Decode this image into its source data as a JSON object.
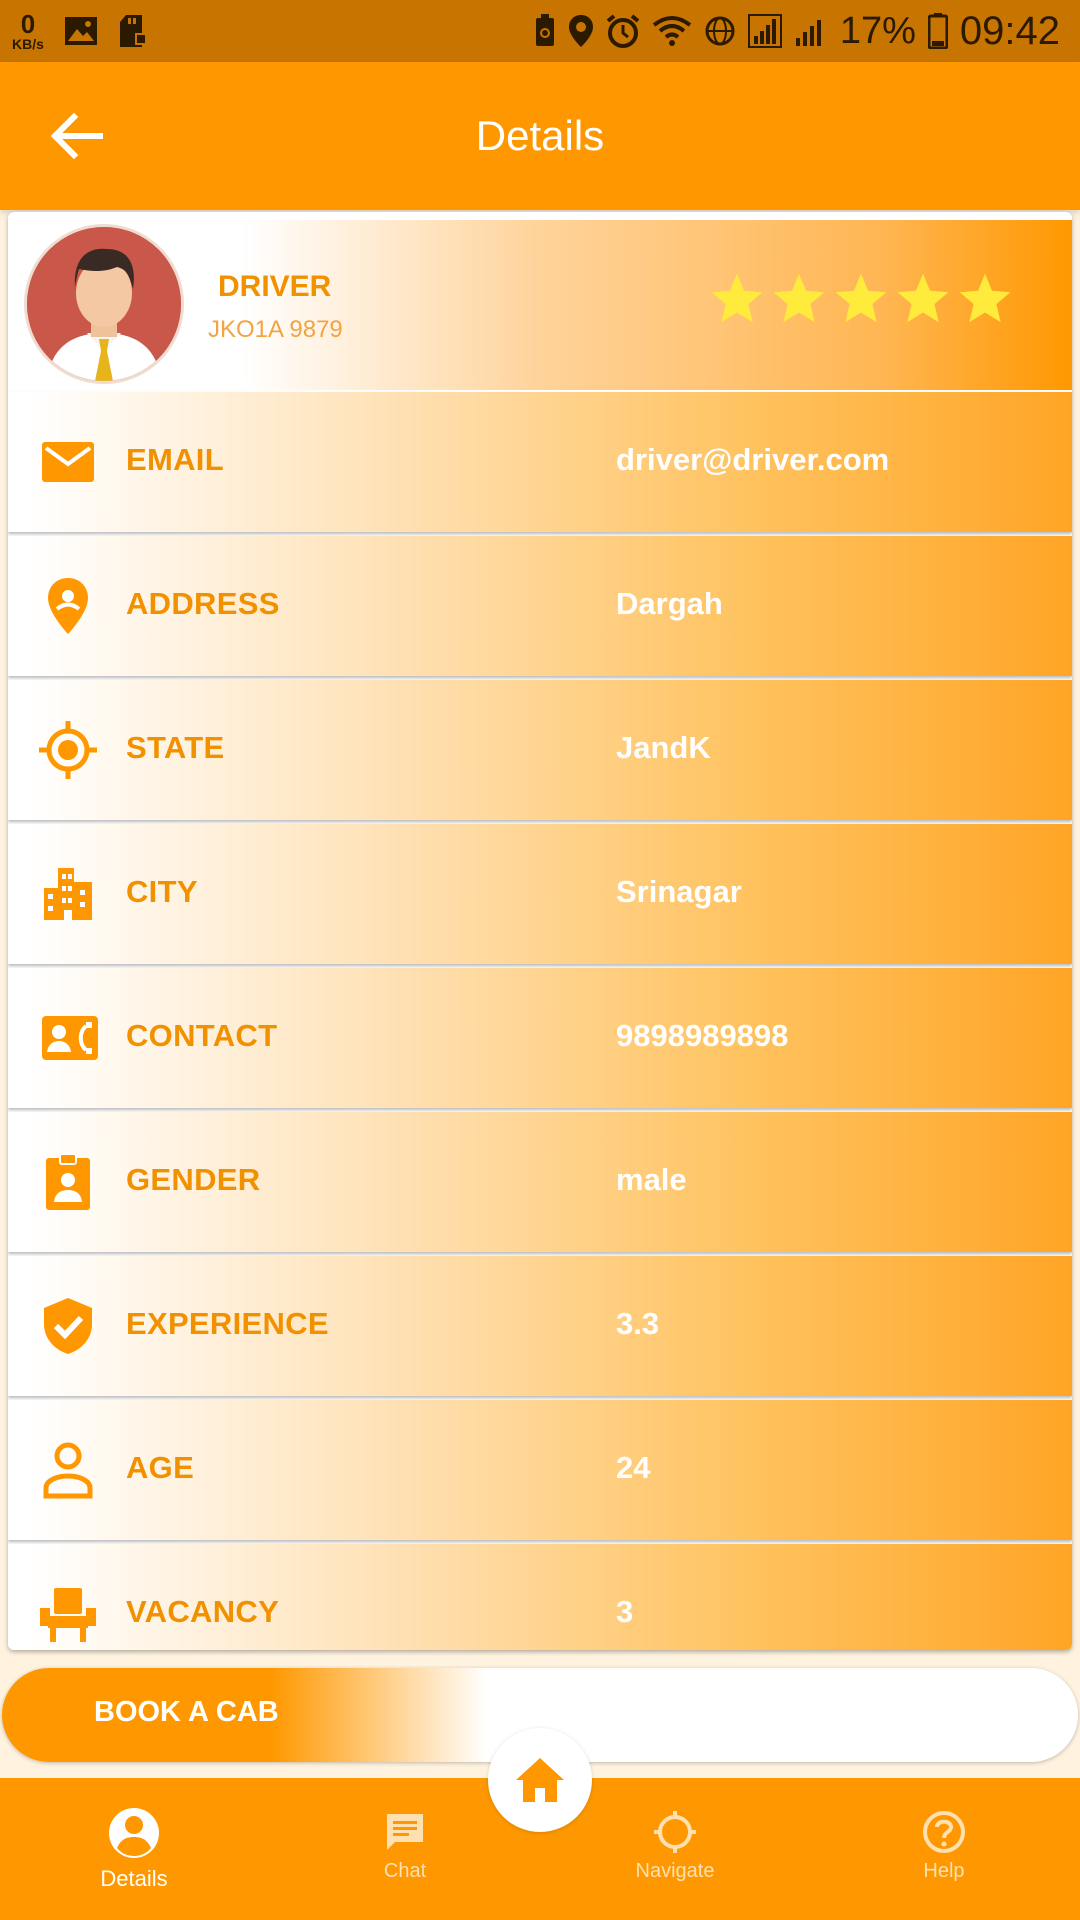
{
  "status_bar": {
    "net_speed_value": "0",
    "net_speed_unit": "KB/s",
    "battery": "17%",
    "time": "09:42",
    "icons": [
      "gallery-icon",
      "sd-card-icon",
      "recycle-icon",
      "location-icon",
      "alarm-icon",
      "wifi-icon",
      "globe-icon",
      "signal-icon",
      "battery-icon"
    ]
  },
  "appbar": {
    "title": "Details",
    "back_icon": "arrow-back-icon"
  },
  "profile": {
    "name": "DRIVER",
    "vehicle_number": "JKO1A 9879",
    "rating": 5,
    "rating_max": 5
  },
  "details": [
    {
      "icon": "email-icon",
      "label": "EMAIL",
      "value": "driver@driver.com"
    },
    {
      "icon": "location-pin-icon",
      "label": "ADDRESS",
      "value": "Dargah"
    },
    {
      "icon": "gps-target-icon",
      "label": "STATE",
      "value": "JandK"
    },
    {
      "icon": "building-icon",
      "label": "CITY",
      "value": "Srinagar"
    },
    {
      "icon": "contact-phone-icon",
      "label": "CONTACT",
      "value": "9898989898"
    },
    {
      "icon": "badge-icon",
      "label": "GENDER",
      "value": "male"
    },
    {
      "icon": "verified-shield-icon",
      "label": "EXPERIENCE",
      "value": "3.3"
    },
    {
      "icon": "person-icon",
      "label": "AGE",
      "value": "24"
    },
    {
      "icon": "seat-icon",
      "label": "VACANCY",
      "value": "3"
    }
  ],
  "book_button": {
    "label": "BOOK A CAB"
  },
  "bottom_nav": [
    {
      "label": "Details",
      "icon": "account-circle-icon",
      "active": true
    },
    {
      "label": "Chat",
      "icon": "chat-icon",
      "active": false
    },
    {
      "label": "Navigate",
      "icon": "navigate-icon",
      "active": false
    },
    {
      "label": "Help",
      "icon": "help-icon",
      "active": false
    }
  ],
  "home_fab": {
    "icon": "home-icon"
  },
  "colors": {
    "primary": "#ff9800",
    "status_bar": "#c77500",
    "label_text": "#f29100",
    "star": "#ffeb3b",
    "background": "#fff3e0"
  }
}
